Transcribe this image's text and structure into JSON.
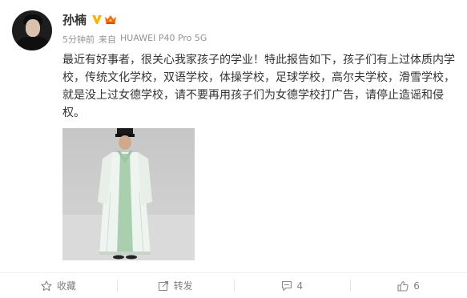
{
  "post": {
    "author": "孙楠",
    "time": "5分钟前",
    "source_prefix": "来自",
    "source": "HUAWEI P40 Pro 5G",
    "text": "最近有好事者，很关心我家孩子的学业！特此报告如下，孩子们有上过体质内学校，传统文化学校，双语学校，体操学校，足球学校，高尔夫学校，滑雪学校，就是没上过女德学校，请不要再用孩子们为女德学校打广告，请停止造谣和侵权。",
    "badge_color": "#f7b500",
    "accent_color": "#ff8200"
  },
  "actions": {
    "favorite_label": "收藏",
    "repost_label": "转发",
    "comment_count": "4",
    "like_count": "6"
  },
  "icons": {
    "verified": "verified-v-icon",
    "crown": "crown-icon",
    "favorite": "star-icon",
    "repost": "share-icon",
    "comment": "comment-icon",
    "like": "thumbs-up-icon"
  }
}
